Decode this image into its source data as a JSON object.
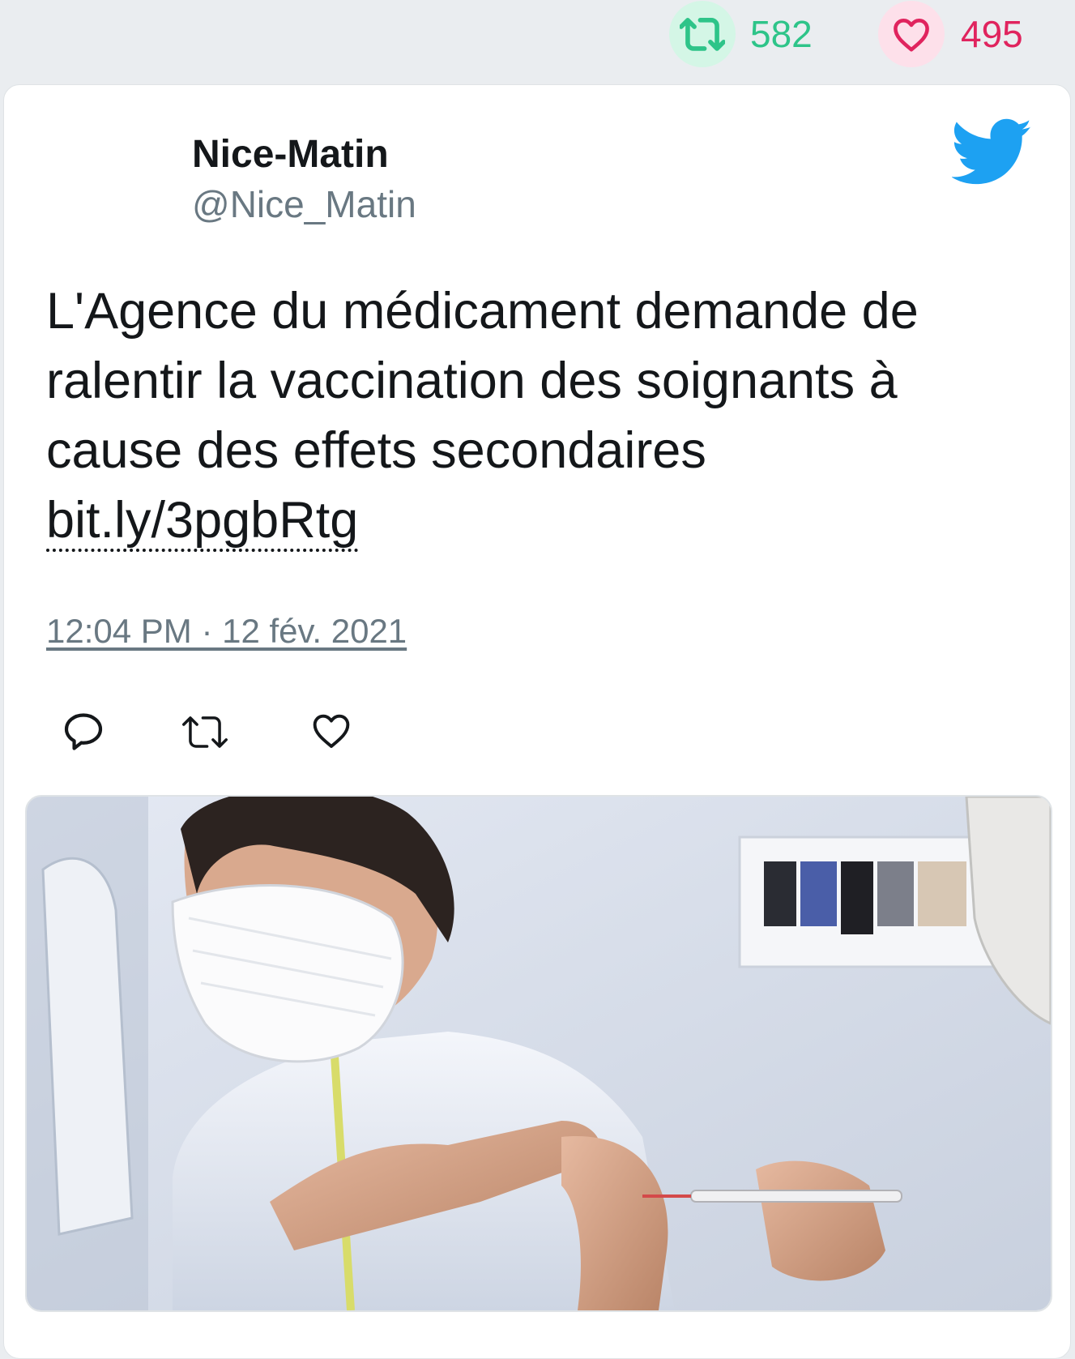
{
  "stats": {
    "retweet_count": "582",
    "like_count": "495",
    "retweet_icon": "retweet-icon",
    "like_icon": "heart-icon",
    "retweet_color": "#2ec489",
    "like_color": "#e0245e"
  },
  "tweet": {
    "display_name": "Nice-Matin",
    "handle": "@Nice_Matin",
    "text": "L'Agence du médicament demande de ralentir la vaccination des soignants à cause des effets secondaires",
    "link": "bit.ly/3pgbRtg",
    "timestamp": "12:04 PM · 12 fév. 2021",
    "brand_icon": "twitter-bird-icon",
    "brand_color": "#1da1f2"
  },
  "actions": [
    {
      "name": "reply",
      "icon": "reply-icon"
    },
    {
      "name": "retweet",
      "icon": "retweet-icon"
    },
    {
      "name": "like",
      "icon": "heart-icon"
    }
  ]
}
